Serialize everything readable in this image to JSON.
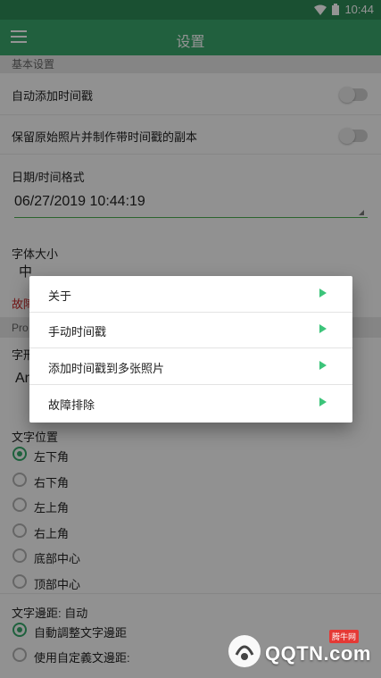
{
  "status": {
    "time": "10:44"
  },
  "appbar": {
    "title": "设置",
    "menu_icon": "hamburger-menu-icon"
  },
  "sections": {
    "basic": "基本设置",
    "pro": "Pro"
  },
  "settings": {
    "auto_timestamp": "自动添加时间戳",
    "keep_original": "保留原始照片并制作带时间戳的副本",
    "datetime_format_label": "日期/时间格式",
    "datetime_format_value": "06/27/2019 10:44:19",
    "font_size_label": "字体大小",
    "font_size_value": "中",
    "troubleshoot_partial": "故障",
    "font_partial_label": "字形",
    "font_partial_value": "Ar"
  },
  "text_position": {
    "label": "文字位置",
    "options": [
      "左下角",
      "右下角",
      "左上角",
      "右上角",
      "底部中心",
      "顶部中心"
    ],
    "selected": 0
  },
  "margin": {
    "label": "文字邊距: 自动",
    "options": [
      "自動調整文字邊距",
      "使用自定義文邊距:"
    ],
    "selected": 0
  },
  "dialog": {
    "items": [
      "关于",
      "手动时间戳",
      "添加时间戳到多张照片",
      "故障排除"
    ]
  },
  "watermark": {
    "brand": "QQTN.com",
    "badge": "腾牛网"
  },
  "colors": {
    "primary": "#3aa56b",
    "accent": "#3cc47a"
  }
}
